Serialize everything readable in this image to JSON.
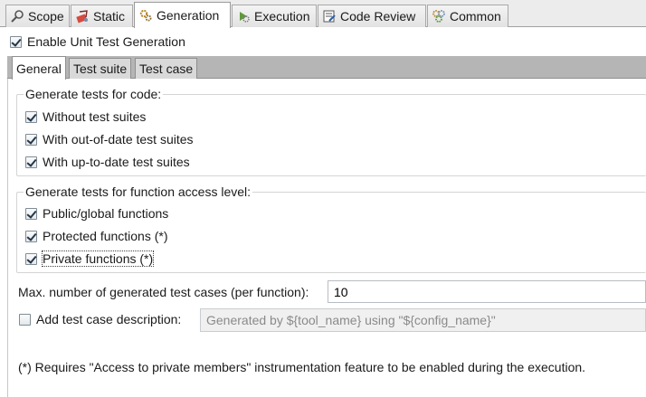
{
  "top_tabs": [
    {
      "label": "Scope",
      "icon": "scope-icon"
    },
    {
      "label": "Static",
      "icon": "static-icon"
    },
    {
      "label": "Generation",
      "icon": "generation-icon",
      "active": true
    },
    {
      "label": "Execution",
      "icon": "execution-icon"
    },
    {
      "label": "Code Review",
      "icon": "code-review-icon"
    },
    {
      "label": "Common",
      "icon": "common-icon"
    }
  ],
  "enable_unit_test_generation": {
    "label": "Enable Unit Test Generation",
    "checked": true
  },
  "inner_tabs": [
    {
      "label": "General",
      "active": true
    },
    {
      "label": "Test suite"
    },
    {
      "label": "Test case"
    }
  ],
  "code_group": {
    "title": "Generate tests for code:",
    "options": [
      {
        "label": "Without test suites",
        "checked": true
      },
      {
        "label": "With out-of-date test suites",
        "checked": true
      },
      {
        "label": "With up-to-date test suites",
        "checked": true
      }
    ]
  },
  "access_group": {
    "title": "Generate tests for function access level:",
    "options": [
      {
        "label": "Public/global functions",
        "checked": true
      },
      {
        "label": "Protected functions (*)",
        "checked": true
      },
      {
        "label": "Private functions (*)",
        "checked": true
      }
    ]
  },
  "max_cases": {
    "label": "Max. number of generated test cases (per function):",
    "value": "10"
  },
  "description": {
    "label": "Add test case description:",
    "checked": false,
    "value": "Generated by ${tool_name} using \"${config_name}\""
  },
  "footnote": "(*) Requires \"Access to private members\" instrumentation feature to be enabled during the execution.",
  "colors": {
    "accent": "#243648",
    "tab_bar": "#ececec",
    "inner_bar": "#b5b5b5"
  }
}
